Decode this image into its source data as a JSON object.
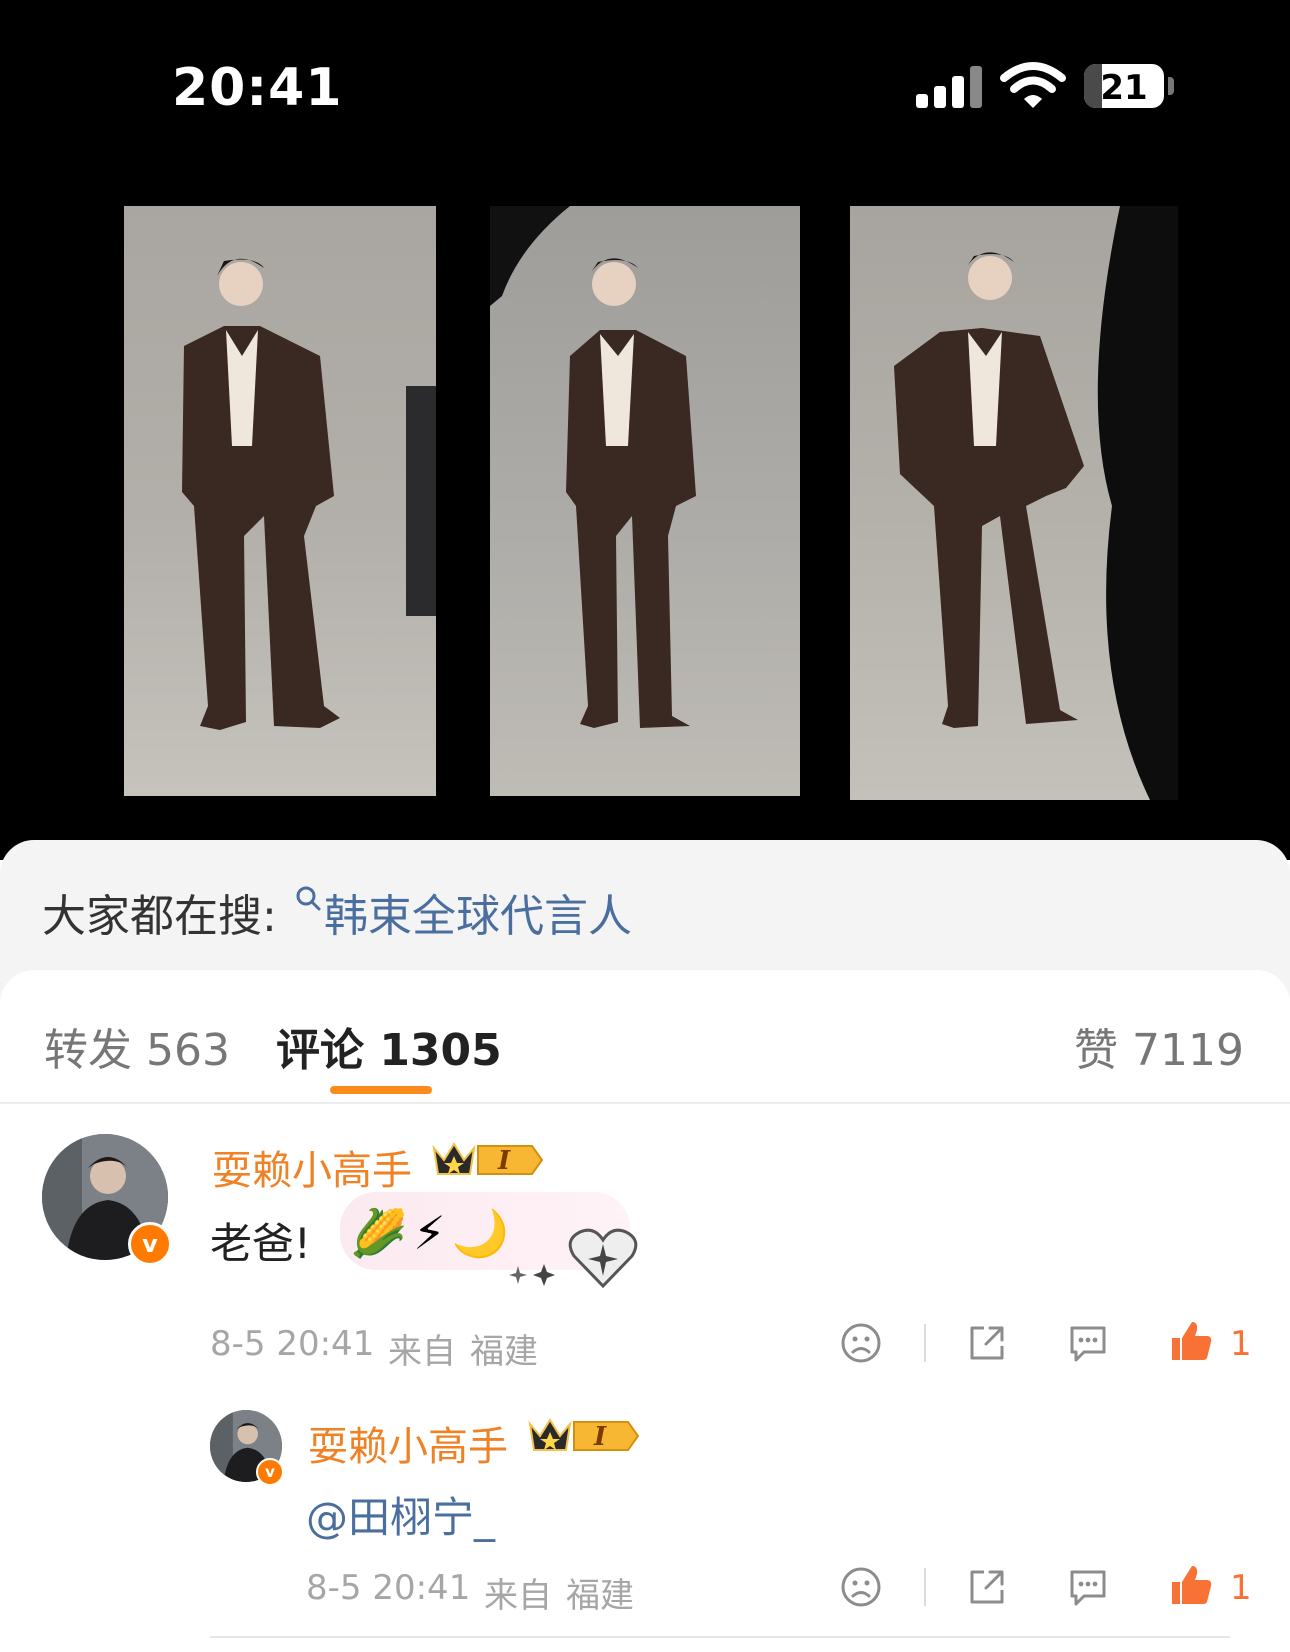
{
  "status_bar": {
    "time": "20:41",
    "battery": "21"
  },
  "search_suggestion": {
    "label": "大家都在搜:",
    "term": "韩束全球代言人"
  },
  "tabs": {
    "repost": "转发 563",
    "comments": "评论 1305",
    "likes": "赞 7119"
  },
  "comments": [
    {
      "username": "耍赖小高手",
      "level": "I",
      "text": "老爸!",
      "emojis": "🌽⚡🌙",
      "time": "8-5 20:41",
      "from": "来自",
      "location": "福建",
      "like_count": "1"
    },
    {
      "username": "耍赖小高手",
      "level": "I",
      "text": "@田栩宁_",
      "time": "8-5 20:41",
      "from": "来自",
      "location": "福建",
      "like_count": "1"
    }
  ],
  "colors": {
    "accent": "#ff8a1c",
    "username": "#f08226",
    "link": "#4a6f9e",
    "like": "#f77234"
  }
}
